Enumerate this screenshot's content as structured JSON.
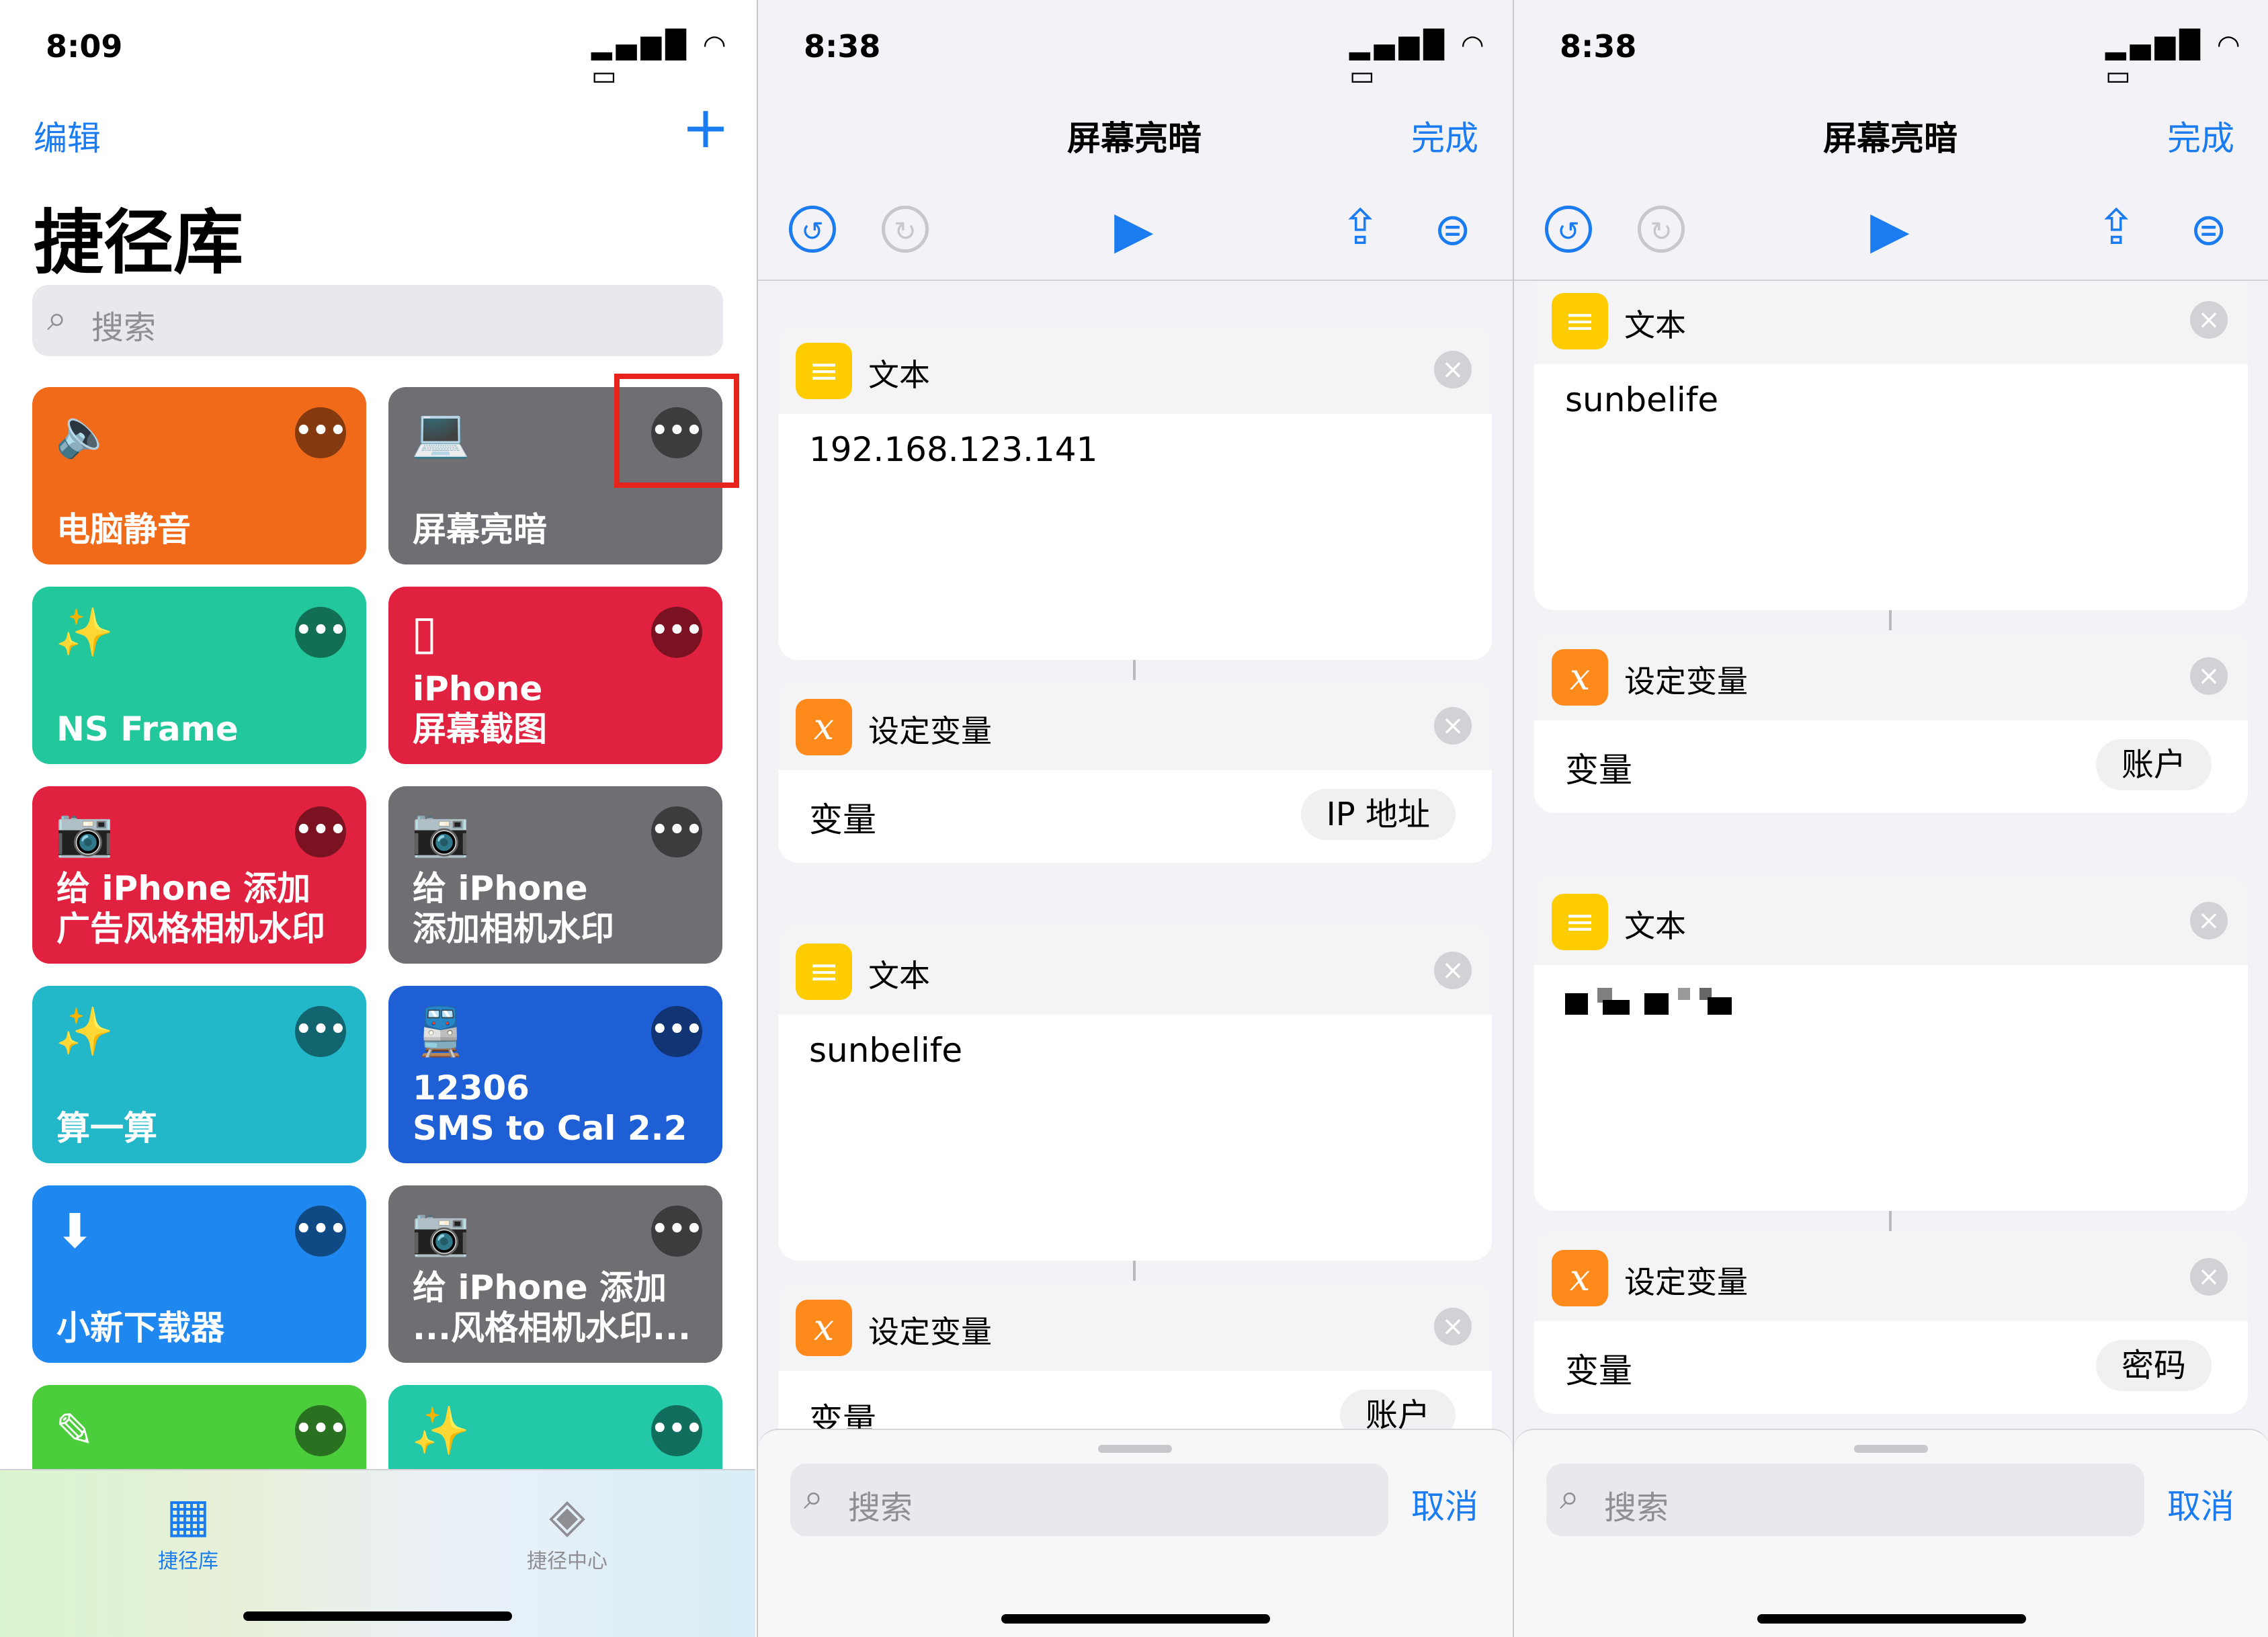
{
  "panel1": {
    "status": {
      "time": "8:09"
    },
    "edit_label": "编辑",
    "add_label": "+",
    "title": "捷径库",
    "search_placeholder": "搜索",
    "tiles": [
      {
        "label": "电脑静音",
        "icon": "speaker-icon",
        "glyph": "🔈",
        "color": "#f06a1a"
      },
      {
        "label": "屏幕亮暗",
        "icon": "laptop-icon",
        "glyph": "💻",
        "color": "#6e6e73"
      },
      {
        "label": "NS Frame",
        "icon": "magic-wand-icon",
        "glyph": "✨",
        "color": "#22c89c"
      },
      {
        "label": "iPhone\n屏幕截图",
        "icon": "phone-icon",
        "glyph": "▯",
        "color": "#e0213f"
      },
      {
        "label": "给 iPhone 添加\n广告风格相机水印",
        "icon": "camera-icon",
        "glyph": "📷",
        "color": "#e0213f"
      },
      {
        "label": "给 iPhone\n添加相机水印",
        "icon": "camera-icon",
        "glyph": "📷",
        "color": "#6e6e73"
      },
      {
        "label": "算一算",
        "icon": "magic-wand-icon",
        "glyph": "✨",
        "color": "#22b7c9"
      },
      {
        "label": "12306\nSMS to Cal 2.2",
        "icon": "train-icon",
        "glyph": "🚆",
        "color": "#1f5fd6"
      },
      {
        "label": "小新下载器",
        "icon": "download-icon",
        "glyph": "⬇",
        "color": "#1e88f0"
      },
      {
        "label": "给 iPhone 添加\n...风格相机水印...",
        "icon": "camera-icon",
        "glyph": "📷",
        "color": "#6e6e73"
      },
      {
        "label": "",
        "icon": "pencil-icon",
        "glyph": "✎",
        "color": "#4ccd3c"
      },
      {
        "label": "",
        "icon": "magic-wand-icon",
        "glyph": "✨",
        "color": "#22c8a8"
      }
    ],
    "tabs": [
      {
        "label": "捷径库",
        "icon": "grid-icon",
        "active": true
      },
      {
        "label": "捷径中心",
        "icon": "layers-icon",
        "active": false
      }
    ]
  },
  "panel2": {
    "status": {
      "time": "8:38"
    },
    "nav_title": "屏幕亮暗",
    "done_label": "完成",
    "card1": {
      "title": "文本",
      "text": "192.168.123.141"
    },
    "card2": {
      "title": "设定变量",
      "row_label": "变量",
      "value": "IP 地址"
    },
    "card3": {
      "title": "文本",
      "text": "sunbelife"
    },
    "card4": {
      "title": "设定变量",
      "row_label": "变量",
      "value": "账户"
    },
    "search_placeholder": "搜索",
    "cancel_label": "取消"
  },
  "panel3": {
    "status": {
      "time": "8:38"
    },
    "nav_title": "屏幕亮暗",
    "done_label": "完成",
    "card1": {
      "title": "文本",
      "text": "sunbelife"
    },
    "card2": {
      "title": "设定变量",
      "row_label": "变量",
      "value": "账户"
    },
    "card3": {
      "title": "文本"
    },
    "card4": {
      "title": "设定变量",
      "row_label": "变量",
      "value": "密码"
    },
    "search_placeholder": "搜索",
    "cancel_label": "取消"
  },
  "colors": {
    "accent": "#1a7cf0",
    "highlight_box": "#e8231c"
  }
}
